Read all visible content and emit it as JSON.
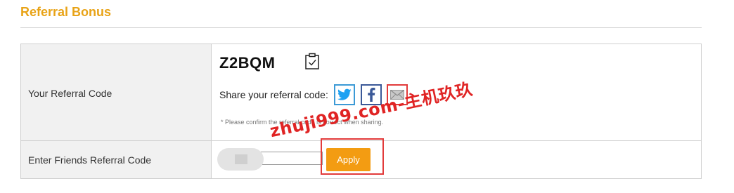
{
  "section": {
    "title": "Referral Bonus"
  },
  "referral": {
    "label": "Your Referral Code",
    "code": "Z2BQM",
    "share_label": "Share your referral code:",
    "note": "* Please confirm the referral code is correct when sharing."
  },
  "friend": {
    "label": "Enter Friends Referral Code",
    "input_value": "",
    "apply_label": "Apply"
  },
  "share_buttons": [
    {
      "name": "twitter-share-button",
      "icon": "twitter-icon",
      "color": "#1da1f2"
    },
    {
      "name": "facebook-share-button",
      "icon": "facebook-icon",
      "color": "#3b5998"
    },
    {
      "name": "email-share-button",
      "icon": "envelope-icon",
      "color": "#999999"
    }
  ],
  "colors": {
    "accent": "#e8a317",
    "apply_button": "#f39c12",
    "highlight_box": "#e23b3b"
  },
  "watermark": {
    "text": "zhuji999.com-主机玖玖"
  }
}
